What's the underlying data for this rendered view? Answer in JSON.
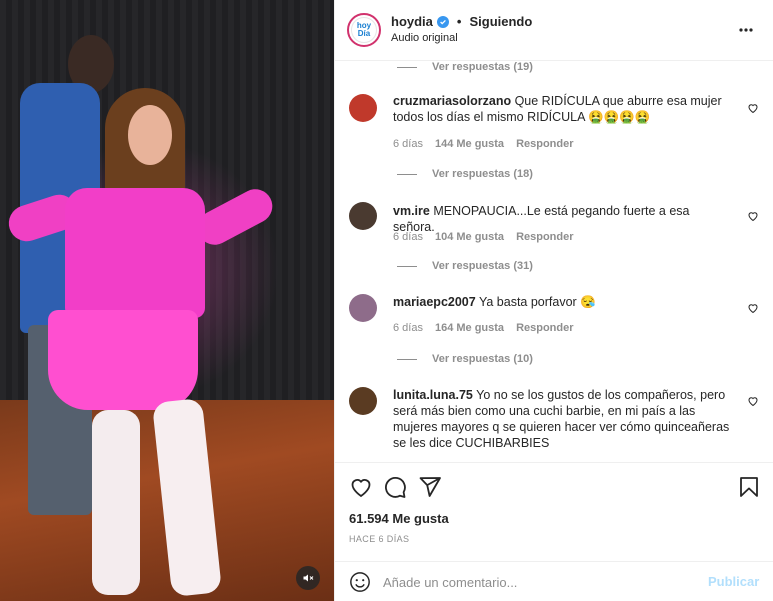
{
  "header": {
    "logo_text": "hoy Día",
    "username": "hoydia",
    "verified_icon": "verified-badge-icon",
    "separator": "•",
    "follow_status": "Siguiendo",
    "audio": "Audio original",
    "more_icon": "more-options-icon"
  },
  "comments": [
    {
      "username": "cruzmariasolorzano",
      "text": "Que RIDÍCULA que aburre esa mujer todos los días el mismo RIDÍCULA 🤮🤮🤮🤮",
      "time": "6 días",
      "likes": "144 Me gusta",
      "reply": "Responder",
      "avatar_color": "#c0392b"
    },
    {
      "username": "vm.ire",
      "text": "MENOPAUCIA...Le está pegando fuerte a esa señora.",
      "time": "6 días",
      "likes": "104 Me gusta",
      "reply": "Responder",
      "avatar_color": "#4a3a30"
    },
    {
      "username": "mariaepc2007",
      "text": "Ya basta porfavor 😪",
      "time": "6 días",
      "likes": "164 Me gusta",
      "reply": "Responder",
      "avatar_color": "#8e6c8a"
    },
    {
      "username": "lunita.luna.75",
      "text": "Yo no se los gustos de los compañeros, pero será más bien como una cuchi barbie, en mi país a las mujeres mayores q se quieren hacer ver cómo quinceañeras se les dice CUCHIBARBIES",
      "avatar_color": "#5a3b22"
    }
  ],
  "view_replies": [
    "Ver respuestas (19)",
    "Ver respuestas (18)",
    "Ver respuestas (31)",
    "Ver respuestas (10)"
  ],
  "actions": {
    "like_icon": "heart-icon",
    "comment_icon": "comment-icon",
    "share_icon": "share-icon",
    "save_icon": "bookmark-icon",
    "likes": "61.594 Me gusta",
    "posted": "HACE 6 DÍAS"
  },
  "add_comment": {
    "emoji_icon": "emoji-icon",
    "placeholder": "Añade un comentario...",
    "publish": "Publicar"
  },
  "video": {
    "mute_icon": "muted-speaker-icon"
  },
  "colors": {
    "link_blue": "#0095f6",
    "publish_disabled": "#b2dffc",
    "muted_text": "#8e8e8e"
  }
}
